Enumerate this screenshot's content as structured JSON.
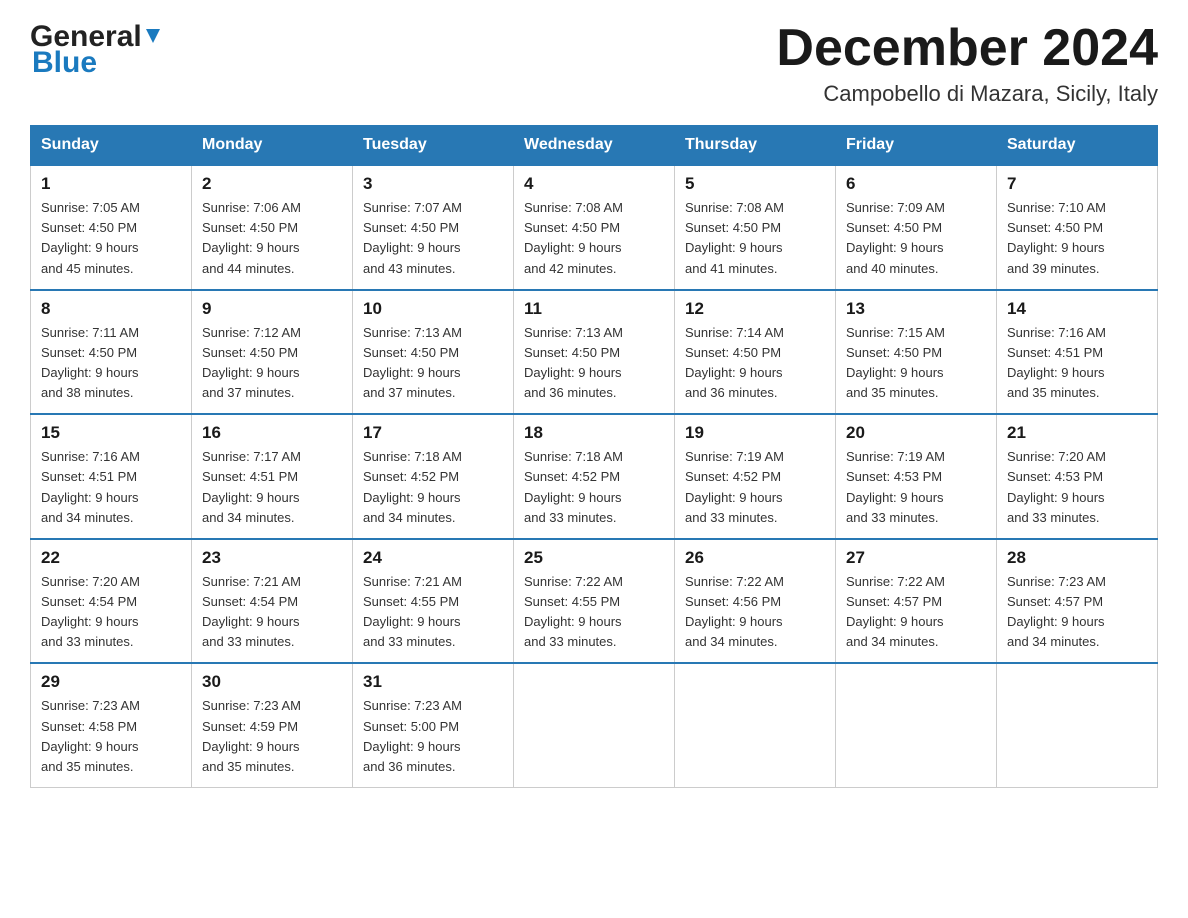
{
  "header": {
    "logo_general": "General",
    "logo_blue": "Blue",
    "month_title": "December 2024",
    "location": "Campobello di Mazara, Sicily, Italy"
  },
  "days_of_week": [
    "Sunday",
    "Monday",
    "Tuesday",
    "Wednesday",
    "Thursday",
    "Friday",
    "Saturday"
  ],
  "weeks": [
    [
      {
        "day": "1",
        "sunrise": "7:05 AM",
        "sunset": "4:50 PM",
        "daylight": "9 hours and 45 minutes."
      },
      {
        "day": "2",
        "sunrise": "7:06 AM",
        "sunset": "4:50 PM",
        "daylight": "9 hours and 44 minutes."
      },
      {
        "day": "3",
        "sunrise": "7:07 AM",
        "sunset": "4:50 PM",
        "daylight": "9 hours and 43 minutes."
      },
      {
        "day": "4",
        "sunrise": "7:08 AM",
        "sunset": "4:50 PM",
        "daylight": "9 hours and 42 minutes."
      },
      {
        "day": "5",
        "sunrise": "7:08 AM",
        "sunset": "4:50 PM",
        "daylight": "9 hours and 41 minutes."
      },
      {
        "day": "6",
        "sunrise": "7:09 AM",
        "sunset": "4:50 PM",
        "daylight": "9 hours and 40 minutes."
      },
      {
        "day": "7",
        "sunrise": "7:10 AM",
        "sunset": "4:50 PM",
        "daylight": "9 hours and 39 minutes."
      }
    ],
    [
      {
        "day": "8",
        "sunrise": "7:11 AM",
        "sunset": "4:50 PM",
        "daylight": "9 hours and 38 minutes."
      },
      {
        "day": "9",
        "sunrise": "7:12 AM",
        "sunset": "4:50 PM",
        "daylight": "9 hours and 37 minutes."
      },
      {
        "day": "10",
        "sunrise": "7:13 AM",
        "sunset": "4:50 PM",
        "daylight": "9 hours and 37 minutes."
      },
      {
        "day": "11",
        "sunrise": "7:13 AM",
        "sunset": "4:50 PM",
        "daylight": "9 hours and 36 minutes."
      },
      {
        "day": "12",
        "sunrise": "7:14 AM",
        "sunset": "4:50 PM",
        "daylight": "9 hours and 36 minutes."
      },
      {
        "day": "13",
        "sunrise": "7:15 AM",
        "sunset": "4:50 PM",
        "daylight": "9 hours and 35 minutes."
      },
      {
        "day": "14",
        "sunrise": "7:16 AM",
        "sunset": "4:51 PM",
        "daylight": "9 hours and 35 minutes."
      }
    ],
    [
      {
        "day": "15",
        "sunrise": "7:16 AM",
        "sunset": "4:51 PM",
        "daylight": "9 hours and 34 minutes."
      },
      {
        "day": "16",
        "sunrise": "7:17 AM",
        "sunset": "4:51 PM",
        "daylight": "9 hours and 34 minutes."
      },
      {
        "day": "17",
        "sunrise": "7:18 AM",
        "sunset": "4:52 PM",
        "daylight": "9 hours and 34 minutes."
      },
      {
        "day": "18",
        "sunrise": "7:18 AM",
        "sunset": "4:52 PM",
        "daylight": "9 hours and 33 minutes."
      },
      {
        "day": "19",
        "sunrise": "7:19 AM",
        "sunset": "4:52 PM",
        "daylight": "9 hours and 33 minutes."
      },
      {
        "day": "20",
        "sunrise": "7:19 AM",
        "sunset": "4:53 PM",
        "daylight": "9 hours and 33 minutes."
      },
      {
        "day": "21",
        "sunrise": "7:20 AM",
        "sunset": "4:53 PM",
        "daylight": "9 hours and 33 minutes."
      }
    ],
    [
      {
        "day": "22",
        "sunrise": "7:20 AM",
        "sunset": "4:54 PM",
        "daylight": "9 hours and 33 minutes."
      },
      {
        "day": "23",
        "sunrise": "7:21 AM",
        "sunset": "4:54 PM",
        "daylight": "9 hours and 33 minutes."
      },
      {
        "day": "24",
        "sunrise": "7:21 AM",
        "sunset": "4:55 PM",
        "daylight": "9 hours and 33 minutes."
      },
      {
        "day": "25",
        "sunrise": "7:22 AM",
        "sunset": "4:55 PM",
        "daylight": "9 hours and 33 minutes."
      },
      {
        "day": "26",
        "sunrise": "7:22 AM",
        "sunset": "4:56 PM",
        "daylight": "9 hours and 34 minutes."
      },
      {
        "day": "27",
        "sunrise": "7:22 AM",
        "sunset": "4:57 PM",
        "daylight": "9 hours and 34 minutes."
      },
      {
        "day": "28",
        "sunrise": "7:23 AM",
        "sunset": "4:57 PM",
        "daylight": "9 hours and 34 minutes."
      }
    ],
    [
      {
        "day": "29",
        "sunrise": "7:23 AM",
        "sunset": "4:58 PM",
        "daylight": "9 hours and 35 minutes."
      },
      {
        "day": "30",
        "sunrise": "7:23 AM",
        "sunset": "4:59 PM",
        "daylight": "9 hours and 35 minutes."
      },
      {
        "day": "31",
        "sunrise": "7:23 AM",
        "sunset": "5:00 PM",
        "daylight": "9 hours and 36 minutes."
      },
      null,
      null,
      null,
      null
    ]
  ],
  "labels": {
    "sunrise": "Sunrise:",
    "sunset": "Sunset:",
    "daylight": "Daylight:"
  }
}
